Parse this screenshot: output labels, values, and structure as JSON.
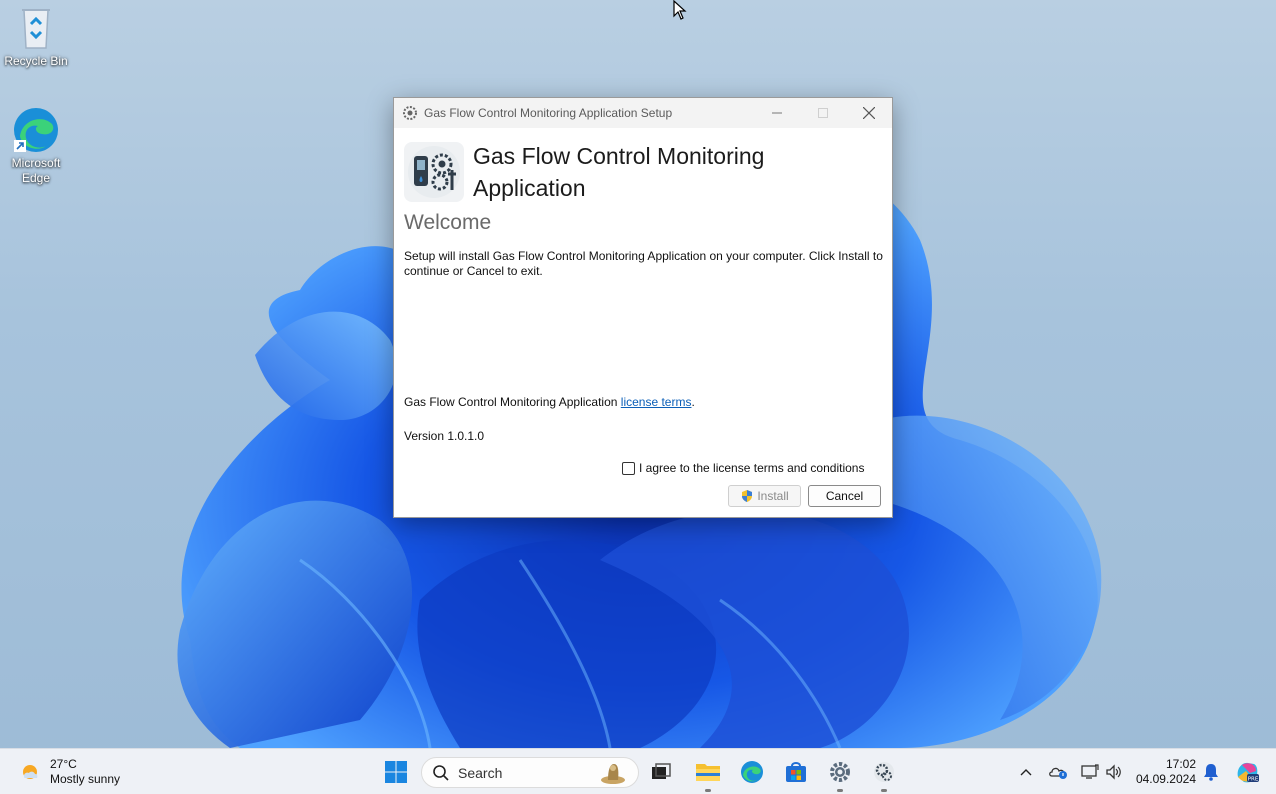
{
  "desktop": {
    "icons": [
      {
        "label": "Recycle Bin"
      },
      {
        "label": "Microsoft Edge"
      }
    ]
  },
  "dialog": {
    "title": "Gas Flow Control Monitoring Application Setup",
    "app_name": "Gas Flow Control Monitoring Application",
    "heading": "Welcome",
    "description": "Setup will install Gas Flow Control Monitoring Application on your computer. Click Install to continue or Cancel to exit.",
    "license_prefix": "Gas Flow Control Monitoring Application",
    "license_link": "license terms",
    "license_suffix": ".",
    "version": "Version 1.0.1.0",
    "agree_label": "I agree to the license terms and conditions",
    "agree_checked": false,
    "install_label": "Install",
    "cancel_label": "Cancel"
  },
  "taskbar": {
    "weather": {
      "temp": "27°C",
      "condition": "Mostly sunny"
    },
    "search_placeholder": "Search",
    "clock": {
      "time": "17:02",
      "date": "04.09.2024"
    }
  },
  "colors": {
    "accent": "#0b5fb8",
    "wallpaper_blue": "#1a5fe0"
  }
}
